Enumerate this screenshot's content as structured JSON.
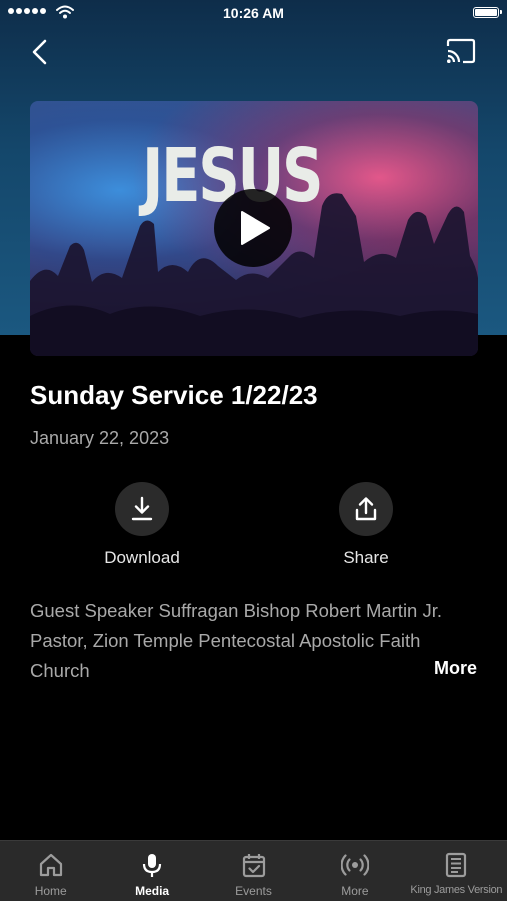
{
  "status_bar": {
    "time": "10:26 AM"
  },
  "media": {
    "thumbnail_text": "JESUS",
    "title": "Sunday Service 1/22/23",
    "date": "January 22, 2023",
    "actions": {
      "download_label": "Download",
      "share_label": "Share"
    },
    "description": "Guest Speaker Suffragan Bishop Robert Martin Jr. Pastor, Zion Temple Pentecostal Apostolic Faith Church",
    "more_label": "More"
  },
  "tabs": [
    {
      "label": "Home",
      "icon": "home-icon"
    },
    {
      "label": "Media",
      "icon": "microphone-icon",
      "active": true
    },
    {
      "label": "Events",
      "icon": "calendar-check-icon"
    },
    {
      "label": "More",
      "icon": "broadcast-icon"
    },
    {
      "label": "King James Version",
      "icon": "book-icon"
    }
  ],
  "colors": {
    "header_blue": "#1b5880",
    "background": "#000000",
    "tab_bar": "#2a2a2a",
    "muted_text": "#a9a9a9"
  }
}
